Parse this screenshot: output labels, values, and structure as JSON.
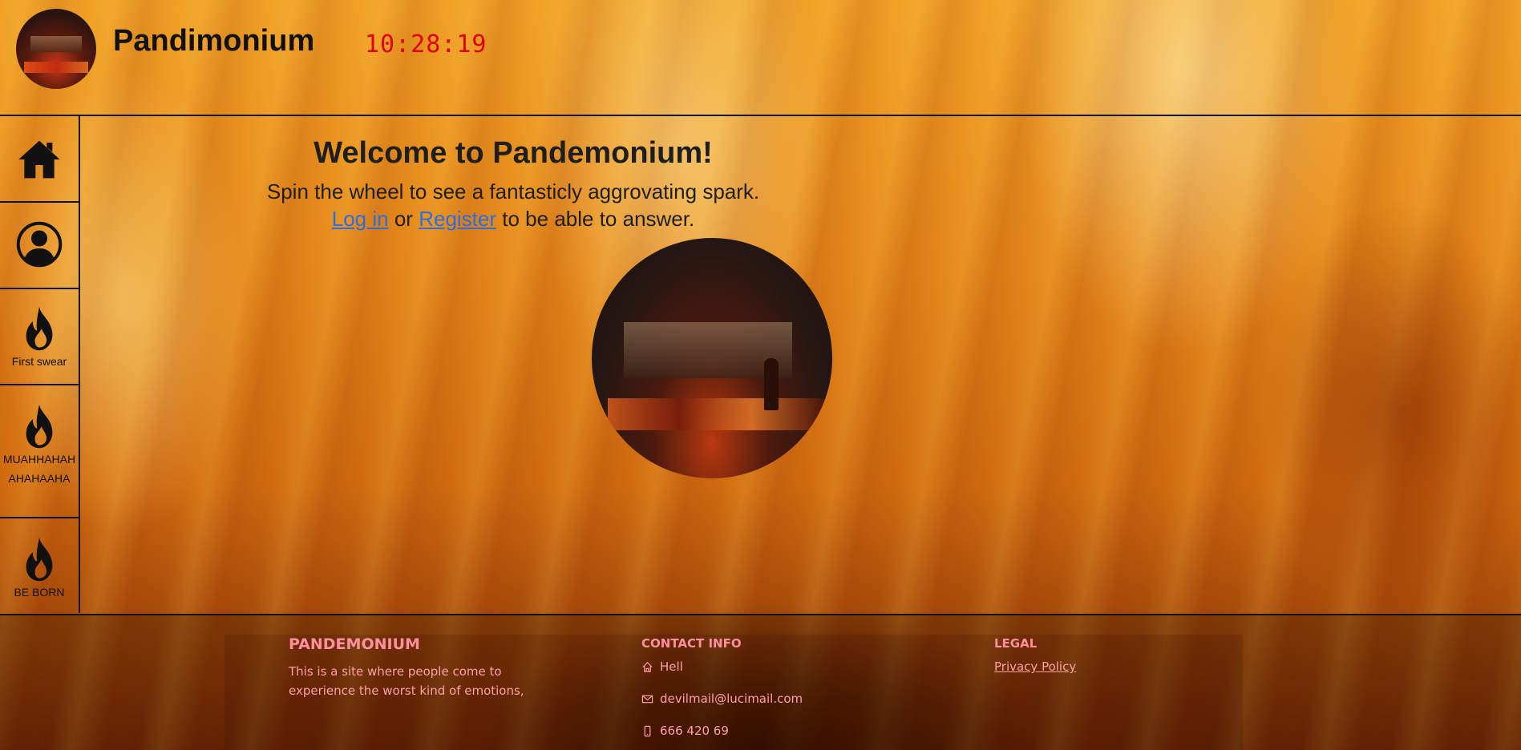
{
  "header": {
    "site_title": "Pandimonium",
    "clock": "10:28:19",
    "logo_icon": "pandemonium-logo"
  },
  "sidebar": {
    "items": [
      {
        "icon": "home-icon",
        "label": ""
      },
      {
        "icon": "user-icon",
        "label": ""
      },
      {
        "icon": "flame-icon",
        "label": "First swear"
      },
      {
        "icon": "flame-icon",
        "label": "MUAHHAHAHAHAHAAHA"
      },
      {
        "icon": "flame-icon",
        "label": "BE BORN"
      }
    ]
  },
  "main": {
    "welcome": "Welcome to Pandemonium!",
    "spin_text": "Spin the wheel to see a fantasticly aggrovating spark.",
    "login_label": "Log in",
    "or_text": "or",
    "register_label": "Register",
    "answer_text": "to be able to answer."
  },
  "footer": {
    "brand": "PANDEMONIUM",
    "description": "This is a site where people come to experience the worst kind of emotions,",
    "contact_heading": "CONTACT INFO",
    "address": "Hell",
    "email": "devilmail@lucimail.com",
    "phone": "666 420 69",
    "legal_heading": "LEGAL",
    "privacy_label": "Privacy Policy"
  },
  "colors": {
    "clock": "#e00000",
    "link": "#2a6fe0",
    "footer_text": "#ffa0a8"
  }
}
